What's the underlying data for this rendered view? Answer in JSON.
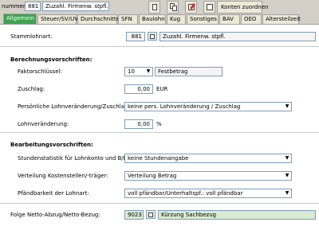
{
  "header": {
    "number_label": "nummer:",
    "number_value": "881",
    "name_value": "Zuzahl. Firmenw. stpfl.",
    "konten_button": "Konten zuordnen"
  },
  "tabs": [
    {
      "label": "Allgemein",
      "active": true
    },
    {
      "label": "Steuer/SV/UV"
    },
    {
      "label": "Durchschnitte"
    },
    {
      "label": "SFN"
    },
    {
      "label": "Baulohn"
    },
    {
      "label": "Kug"
    },
    {
      "label": "Sonstiges"
    },
    {
      "label": "BAV"
    },
    {
      "label": "OEO"
    },
    {
      "label": "Altersteilzeit"
    }
  ],
  "stamm": {
    "label": "Stammlohnart:",
    "number": "881",
    "name": "Zuzahl. Firmenw. stpfl."
  },
  "berechnung": {
    "title": "Berechnungsvorschriften:",
    "faktor_label": "Faktorschlüssel:",
    "faktor_value": "10",
    "faktor_text": "Festbetrag",
    "zuschlag_label": "Zuschlag:",
    "zuschlag_value": "0,00",
    "zuschlag_unit": "EUR",
    "pers_label": "Persönliche Lohnveränderung/Zuschlag:",
    "pers_value": "keine pers. Lohnveränderung / Zuschlag",
    "lohnver_label": "Lohnveränderung:",
    "lohnver_value": "0,00",
    "lohnver_unit": "%"
  },
  "bearbeitung": {
    "title": "Bearbeitungsvorschriften:",
    "stunden_label": "Stundenstatistik für Lohnkonto und B/N:",
    "stunden_value": "keine Stundenangabe",
    "kosten_label": "Verteilung Kostenstellen/-träger:",
    "kosten_value": "Verteilung Betrag",
    "pfaend_label": "Pfändbarkeit der Lohnart:",
    "pfaend_value": "voll pfändbar/Unterhaltspf.: voll pfändbar"
  },
  "folge": {
    "label": "Folge Netto-Abzug/Netto-Bezug:",
    "number": "9023",
    "name": "Kürzung Sachbezug"
  }
}
